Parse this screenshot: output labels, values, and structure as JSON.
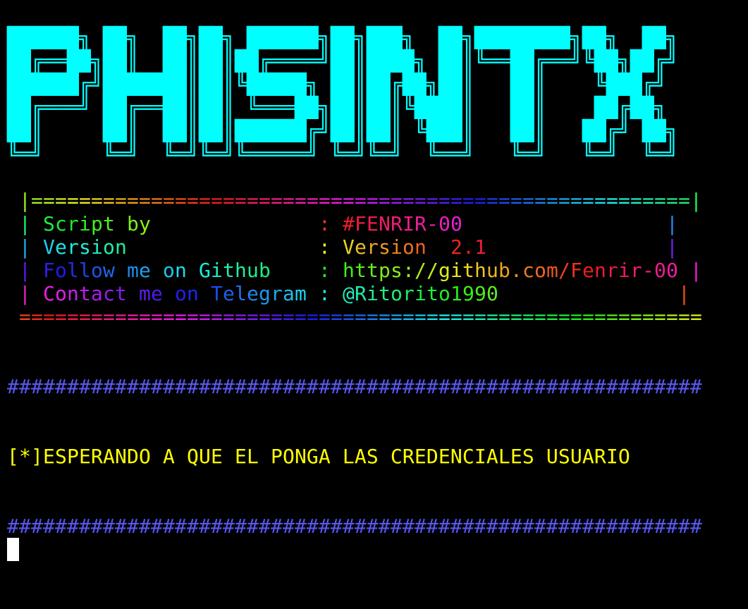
{
  "colors": {
    "banner": "#00ffff",
    "hash": "#5858f0",
    "message": "#ffff00",
    "cursor": "#ffffff"
  },
  "banner": {
    "text": "PHISINTX",
    "lines": [
      "██████╗ ██╗  ██╗██╗ ██████╗██╗███╗  ██╗████████╗██╗  ██╗",
      "██╔══██╗██║  ██║██║██╔════╝██║████╗ ██║╚══██╔══╝╚██╗██╔╝",
      "██████╔╝███████║██║╚█████╗ ██║██╔██╗██║   ██║    ╚███╔╝ ",
      "██╔═══╝ ██╔══██║██║ ╚═══██╗██║██║╚████║   ██║    ██╔██╗ ",
      "██║     ██║  ██║██║██████╔╝██║██║ ╚███║   ██║   ██╔╝ ██╗",
      "╚═╝     ╚═╝  ╚═╝╚═╝╚═════╝ ╚═╝╚═╝  ╚══╝   ╚═╝   ╚═╝  ╚═╝"
    ]
  },
  "info_box": {
    "top_border": " |=======================================================|",
    "rows": [
      " | Script by              : #FENRIR-00                 |",
      " | Version                : Version  2.1               |",
      " | Follow me on Github    : https://github.com/Fenrir-00 |",
      " | Contact me on Telegram : @Ritorito1990               |"
    ],
    "bottom_border": " ========================================================="
  },
  "separator": "##########################################################",
  "status_message": "[*]ESPERANDO A QUE EL PONGA LAS CREDENCIALES USUARIO"
}
